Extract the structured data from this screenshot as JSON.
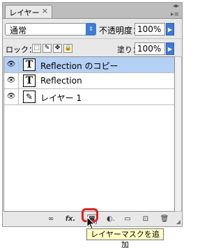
{
  "panel": {
    "tab_label": "レイヤー",
    "tab_close": "×",
    "window_controls": "◂▸",
    "menu_icon": "▸≡"
  },
  "blend_mode": {
    "value": "通常",
    "arrow": "⇕"
  },
  "opacity": {
    "label": "不透明度：",
    "value": "100%",
    "arrow": "▶"
  },
  "lock": {
    "label": "ロック：",
    "buttons": [
      {
        "icon": "lock-transparent-icon",
        "glyph": "⬚"
      },
      {
        "icon": "lock-image-icon",
        "glyph": "✎"
      },
      {
        "icon": "lock-position-icon",
        "glyph": "✥"
      },
      {
        "icon": "lock-all-icon",
        "glyph": "🔒"
      }
    ]
  },
  "fill": {
    "label": "塗り：",
    "value": "100%",
    "arrow": "▶"
  },
  "layers": [
    {
      "name": "Reflection のコピー",
      "type": "text",
      "thumb": "T",
      "selected": true,
      "visible": true
    },
    {
      "name": "Reflection",
      "type": "text",
      "thumb": "T",
      "selected": false,
      "visible": true
    },
    {
      "name": "レイヤー 1",
      "type": "normal",
      "thumb": "✎",
      "selected": false,
      "visible": true
    }
  ],
  "bottom_toolbar": {
    "link": "∞",
    "fx": "fx.",
    "mask": "◙",
    "adjustment": "◐.",
    "group": "▭",
    "new_layer": "⊡",
    "delete": "🗑"
  },
  "tooltip": "レイヤーマスクを追加",
  "colors": {
    "selection": "#b5d0f5",
    "highlight": "#e02020",
    "accent": "#3d7bd6"
  }
}
